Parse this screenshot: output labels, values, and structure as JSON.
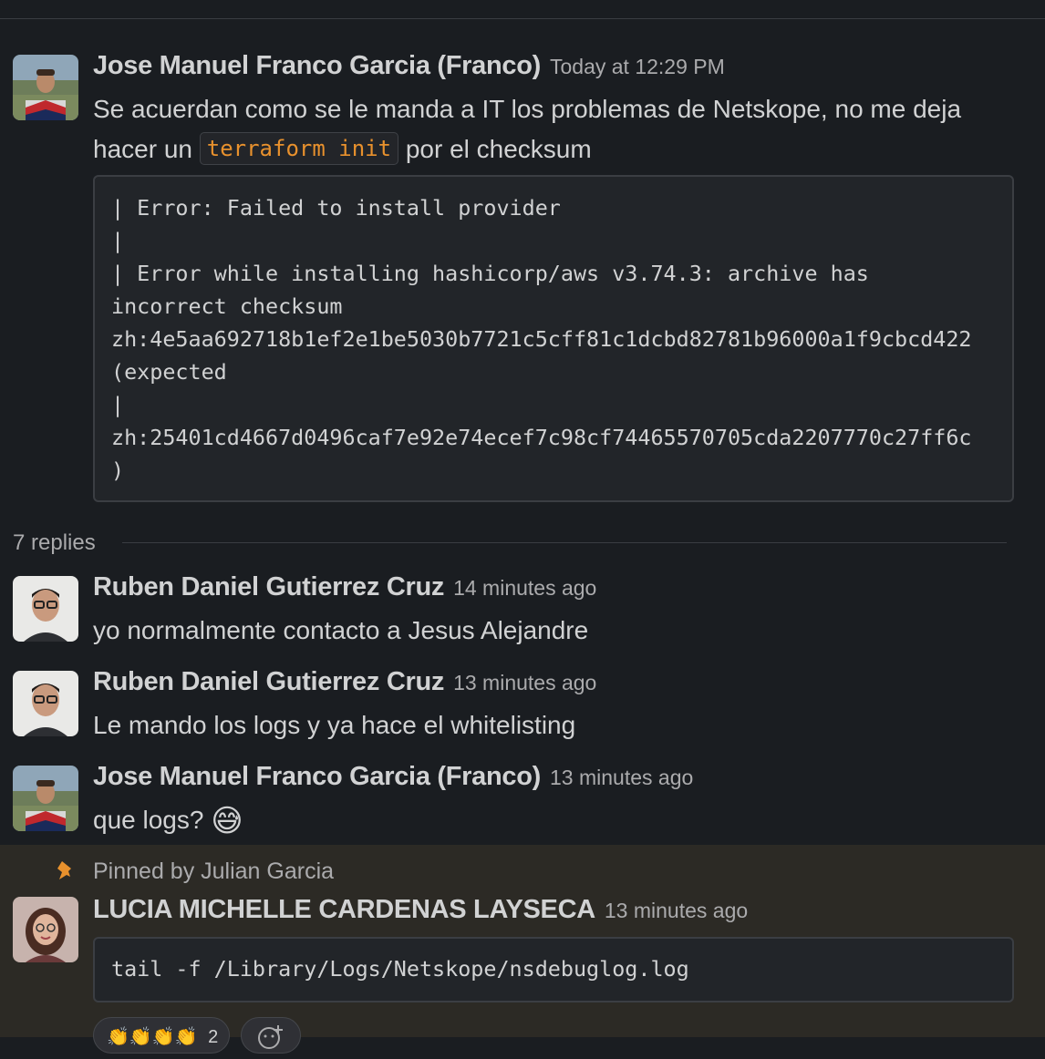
{
  "messages": [
    {
      "author": "Jose Manuel Franco Garcia (Franco)",
      "time": "Today at 12:29 PM",
      "text_line1": "Se acuerdan como se le manda a IT los problemas de Netskope, no me deja",
      "text_line2_before": "hacer un",
      "inline_code": "terraform init",
      "text_line2_after": "por el checksum",
      "code_lines": [
        "| Error: Failed to install provider",
        "|",
        "| Error while installing hashicorp/aws v3.74.3: archive has",
        "incorrect checksum",
        "zh:4e5aa692718b1ef2e1be5030b7721c5cff81c1dcbd82781b96000a1f9cbcd422",
        "(expected",
        "|",
        "zh:25401cd4667d0496caf7e92e74ecef7c98cf74465570705cda2207770c27ff6c",
        ")"
      ]
    }
  ],
  "thread": {
    "replies_label": "7 replies",
    "replies": [
      {
        "author": "Ruben Daniel Gutierrez Cruz",
        "time": "14 minutes ago",
        "text": "yo normalmente contacto a Jesus Alejandre"
      },
      {
        "author": "Ruben Daniel Gutierrez Cruz",
        "time": "13 minutes ago",
        "text": "Le mando los logs y ya hace el whitelisting"
      },
      {
        "author": "Jose Manuel Franco Garcia (Franco)",
        "time": "13 minutes ago",
        "text": "que logs?",
        "emoji": "😅"
      }
    ],
    "pinned": {
      "pinned_by": "Pinned by Julian Garcia",
      "author": "LUCIA MICHELLE CARDENAS LAYSECA",
      "time": "13 minutes ago",
      "code": "tail -f /Library/Logs/Netskope/nsdebuglog.log",
      "reaction": {
        "emoji": "👏👏👏👏",
        "count": "2"
      }
    }
  },
  "colors": {
    "background": "#1a1d21",
    "pinned_background": "#2c2a25",
    "inline_code": "#e8912d",
    "pin_icon": "#e8912d"
  }
}
